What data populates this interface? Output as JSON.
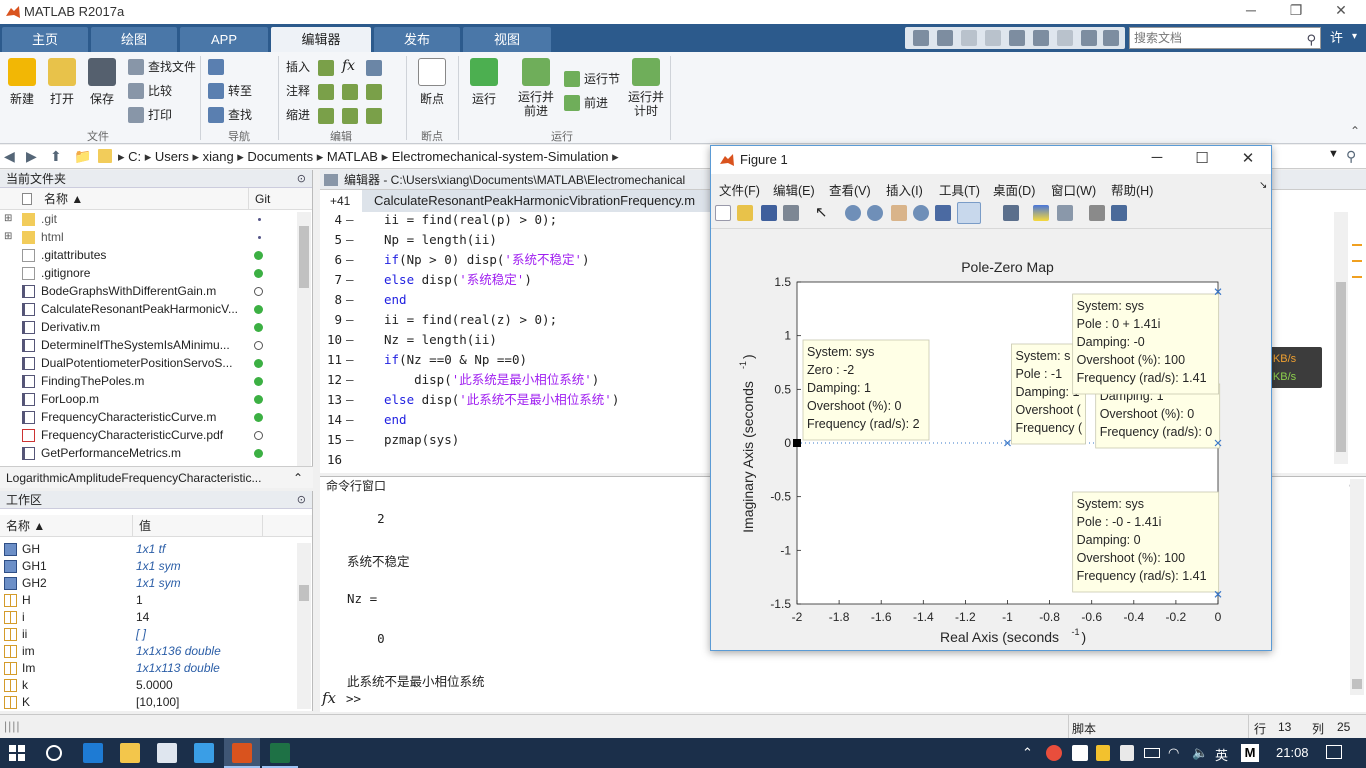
{
  "window": {
    "title": "MATLAB R2017a"
  },
  "ribbon_tabs": [
    "主页",
    "绘图",
    "APP",
    "编辑器",
    "发布",
    "视图"
  ],
  "active_tab": "编辑器",
  "search_docs_placeholder": "搜索文档",
  "user_label": "许",
  "ribbon": {
    "file": {
      "new": "新建",
      "open": "打开",
      "save": "保存",
      "find_files": "查找文件",
      "compare": "比较",
      "print": "打印",
      "group": "文件"
    },
    "navigate": {
      "goto": "转至",
      "find": "查找",
      "group": "导航"
    },
    "edit": {
      "insert": "插入",
      "comment": "注释",
      "indent": "缩进",
      "fx": "fx",
      "group": "编辑"
    },
    "breakpoints": {
      "breakpoints": "断点",
      "group": "断点"
    },
    "run": {
      "run": "运行",
      "run_advance": "运行并\n前进",
      "run_section": "运行节",
      "advance": "前进",
      "run_time": "运行并\n计时",
      "group": "运行"
    }
  },
  "address": {
    "parts": [
      "C:",
      "Users",
      "xiang",
      "Documents",
      "MATLAB",
      "Electromechanical-system-Simulation"
    ]
  },
  "current_folder": {
    "title": "当前文件夹",
    "col_name": "名称 ▲",
    "col_git": "Git",
    "files": [
      {
        "name": ".git",
        "type": "folder",
        "git": "dot",
        "expandable": true
      },
      {
        "name": "html",
        "type": "folder",
        "git": "dot",
        "expandable": true
      },
      {
        "name": ".gitattributes",
        "type": "file",
        "git": "green"
      },
      {
        "name": ".gitignore",
        "type": "file",
        "git": "green"
      },
      {
        "name": "BodeGraphsWithDifferentGain.m",
        "type": "m",
        "git": "open"
      },
      {
        "name": "CalculateResonantPeakHarmonicV...",
        "type": "m",
        "git": "green"
      },
      {
        "name": "Derivativ.m",
        "type": "m",
        "git": "green"
      },
      {
        "name": "DetermineIfTheSystemIsAMinimu...",
        "type": "m",
        "git": "open"
      },
      {
        "name": "DualPotentiometerPositionServoS...",
        "type": "m",
        "git": "green"
      },
      {
        "name": "FindingThePoles.m",
        "type": "m",
        "git": "green"
      },
      {
        "name": "ForLoop.m",
        "type": "m",
        "git": "green"
      },
      {
        "name": "FrequencyCharacteristicCurve.m",
        "type": "m",
        "git": "green"
      },
      {
        "name": "FrequencyCharacteristicCurve.pdf",
        "type": "pdf",
        "git": "open"
      },
      {
        "name": "GetPerformanceMetrics.m",
        "type": "m",
        "git": "green"
      }
    ],
    "details_file": "LogarithmicAmplitudeFrequencyCharacteristic..."
  },
  "workspace": {
    "title": "工作区",
    "col_name": "名称 ▲",
    "col_value": "值",
    "vars": [
      {
        "name": "GH",
        "value": "1x1 tf",
        "italic": true,
        "icon": "obj"
      },
      {
        "name": "GH1",
        "value": "1x1 sym",
        "italic": true,
        "icon": "obj"
      },
      {
        "name": "GH2",
        "value": "1x1 sym",
        "italic": true,
        "icon": "obj"
      },
      {
        "name": "H",
        "value": "1",
        "italic": false,
        "icon": "grid"
      },
      {
        "name": "i",
        "value": "14",
        "italic": false,
        "icon": "grid"
      },
      {
        "name": "ii",
        "value": "[ ]",
        "italic": true,
        "icon": "grid"
      },
      {
        "name": "im",
        "value": "1x1x136 double",
        "italic": true,
        "icon": "grid"
      },
      {
        "name": "Im",
        "value": "1x1x113 double",
        "italic": true,
        "icon": "grid"
      },
      {
        "name": "k",
        "value": "5.0000",
        "italic": false,
        "icon": "grid"
      },
      {
        "name": "K",
        "value": "[10,100]",
        "italic": false,
        "icon": "grid"
      }
    ]
  },
  "editor": {
    "header": "编辑器 - C:\\Users\\xiang\\Documents\\MATLAB\\Electromechanical",
    "tab_plus": "+41",
    "tab_label": "CalculateResonantPeakHarmonicVibrationFrequency.m",
    "lines": [
      {
        "n": "4",
        "dash": "–",
        "parts": [
          [
            "",
            "ii = find(real(p) > 0);"
          ]
        ]
      },
      {
        "n": "5",
        "dash": "–",
        "parts": [
          [
            "",
            "Np = length(ii)"
          ]
        ]
      },
      {
        "n": "6",
        "dash": "–",
        "parts": [
          [
            "kw",
            "if"
          ],
          [
            "",
            "(Np > 0) disp("
          ],
          [
            "str",
            "'系统不稳定'"
          ],
          [
            "",
            ")"
          ]
        ]
      },
      {
        "n": "7",
        "dash": "–",
        "parts": [
          [
            "kw",
            "else"
          ],
          [
            "",
            " disp("
          ],
          [
            "str",
            "'系统稳定'"
          ],
          [
            "",
            ")"
          ]
        ]
      },
      {
        "n": "8",
        "dash": "–",
        "parts": [
          [
            "kw",
            "end"
          ]
        ]
      },
      {
        "n": "9",
        "dash": "–",
        "parts": [
          [
            "",
            "ii = find(real(z) > 0);"
          ]
        ]
      },
      {
        "n": "10",
        "dash": "–",
        "parts": [
          [
            "",
            "Nz = length(ii)"
          ]
        ]
      },
      {
        "n": "11",
        "dash": "–",
        "parts": [
          [
            "kw",
            "if"
          ],
          [
            "",
            "(Nz ==0 & Np ==0)"
          ]
        ]
      },
      {
        "n": "12",
        "dash": "–",
        "parts": [
          [
            "",
            "    disp("
          ],
          [
            "str",
            "'此系统是最小相位系统'"
          ],
          [
            "",
            ")"
          ]
        ]
      },
      {
        "n": "13",
        "dash": "–",
        "parts": [
          [
            "kw",
            "else"
          ],
          [
            "",
            " disp("
          ],
          [
            "str",
            "'此系统不是最小相位系统'"
          ],
          [
            "",
            ")"
          ]
        ]
      },
      {
        "n": "14",
        "dash": "–",
        "parts": [
          [
            "kw",
            "end"
          ]
        ]
      },
      {
        "n": "15",
        "dash": "–",
        "parts": [
          [
            "",
            "pzmap(sys)"
          ]
        ]
      },
      {
        "n": "16",
        "dash": "",
        "parts": []
      }
    ]
  },
  "command_window": {
    "title": "命令行窗口",
    "lines": [
      "    2",
      "",
      "系统不稳定",
      "",
      "Nz =",
      "",
      "    0",
      "",
      "此系统不是最小相位系统"
    ],
    "prompt": ">>"
  },
  "statusbar": {
    "mode": "脚本",
    "row_label": "行",
    "row": "13",
    "col_label": "列",
    "col": "25"
  },
  "taskbar": {
    "ime": "英",
    "ime2": "M",
    "clock": "21:08"
  },
  "netmon": {
    "up": "↑ 0.0 KB/s",
    "down": "↓ 0.0 KB/s"
  },
  "figure": {
    "title": "Figure 1",
    "menus": [
      "文件(F)",
      "编辑(E)",
      "查看(V)",
      "插入(I)",
      "工具(T)",
      "桌面(D)",
      "窗口(W)",
      "帮助(H)"
    ],
    "plot": {
      "title": "Pole-Zero Map",
      "xlabel": "Real Axis (seconds",
      "ylabel": "Imaginary Axis (seconds",
      "exponent": "-1",
      "xlim": [
        -2,
        0
      ],
      "ylim": [
        -1.5,
        1.5
      ],
      "xticks": [
        "-2",
        "-1.8",
        "-1.6",
        "-1.4",
        "-1.2",
        "-1",
        "-0.8",
        "-0.6",
        "-0.4",
        "-0.2",
        "0"
      ],
      "yticks": [
        "1.5",
        "1",
        "0.5",
        "0",
        "-0.5",
        "-1",
        "-1.5"
      ],
      "poles": [
        {
          "x": -1,
          "y": 0
        },
        {
          "x": 0,
          "y": 0
        },
        {
          "x": 0,
          "y": 1.41
        },
        {
          "x": 0,
          "y": -1.41
        }
      ],
      "zeros": [
        {
          "x": -2,
          "y": 0
        }
      ],
      "datatips": [
        {
          "lines": [
            "System: sys",
            "Zero : -2",
            "Damping: 1",
            "Overshoot (%): 0",
            "Frequency (rad/s): 2"
          ]
        },
        {
          "lines": [
            "System: s",
            "Pole : -1",
            "Damping: 1",
            "Overshoot (",
            "Frequency ("
          ]
        },
        {
          "lines": [
            "Damping: 1",
            "Overshoot (%): 0",
            "Frequency (rad/s): 0"
          ]
        },
        {
          "lines": [
            "System: sys",
            "Pole : 0 + 1.41i",
            "Damping: -0",
            "Overshoot (%): 100",
            "Frequency (rad/s): 1.41"
          ]
        },
        {
          "lines": [
            "System: sys",
            "Pole : -0 - 1.41i",
            "Damping: 0",
            "Overshoot (%): 100",
            "Frequency (rad/s): 1.41"
          ]
        }
      ]
    }
  },
  "colors": {
    "ribbon_bar": "#2c5a8c",
    "tab_active": "#eef2f7",
    "git_green": "#3cb043",
    "keyword": "#1f1fe0",
    "string": "#a020f0",
    "pole_marker": "#3a78c9",
    "datatip_bg": "#ffffe6"
  }
}
